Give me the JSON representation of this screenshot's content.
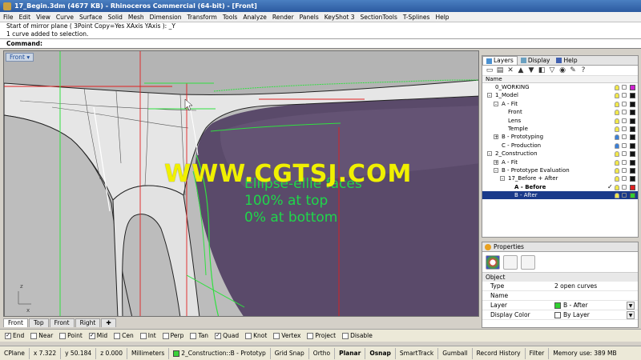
{
  "window": {
    "title": "17_Begin.3dm (4677 KB) - Rhinoceros Commercial (64-bit) - [Front]"
  },
  "menu": [
    "File",
    "Edit",
    "View",
    "Curve",
    "Surface",
    "Solid",
    "Mesh",
    "Dimension",
    "Transform",
    "Tools",
    "Analyze",
    "Render",
    "Panels",
    "KeyShot 3",
    "SectionTools",
    "T-Splines",
    "Help"
  ],
  "command_history": [
    "Start of mirror plane ( 3Point  Copy=Yes  XAxis  YAxis ): _Y",
    "1 curve added to selection."
  ],
  "command_prompt": "Command:",
  "viewport": {
    "label": "Front",
    "overlay_lines": [
      "Ellipse-ellie faces",
      "100%  at top",
      "0% at bottom"
    ],
    "watermark": "WWW.CGTSJ.COM",
    "axis_x": "x",
    "axis_z": "z"
  },
  "viewport_tabs": [
    "Front",
    "Top",
    "Front",
    "Right"
  ],
  "osnap": [
    {
      "label": "End",
      "checked": true
    },
    {
      "label": "Near",
      "checked": false
    },
    {
      "label": "Point",
      "checked": false
    },
    {
      "label": "Mid",
      "checked": true
    },
    {
      "label": "Cen",
      "checked": false
    },
    {
      "label": "Int",
      "checked": false
    },
    {
      "label": "Perp",
      "checked": false
    },
    {
      "label": "Tan",
      "checked": false
    },
    {
      "label": "Quad",
      "checked": true
    },
    {
      "label": "Knot",
      "checked": false
    },
    {
      "label": "Vertex",
      "checked": false
    },
    {
      "label": "Project",
      "checked": false
    },
    {
      "label": "Disable",
      "checked": false
    }
  ],
  "status": {
    "cplane": "CPlane",
    "x": "x 7.322",
    "y": "y 50.184",
    "z": "z 0.000",
    "units": "Millimeters",
    "layer": "2_Construction::B - Prototyp",
    "grid_snap": "Grid Snap",
    "ortho": "Ortho",
    "planar": "Planar",
    "osnap": "Osnap",
    "smarttrack": "SmartTrack",
    "gumball": "Gumball",
    "record_history": "Record History",
    "filter": "Filter",
    "memory": "Memory use: 389 MB"
  },
  "panel_tabs": [
    "Layers",
    "Display",
    "Help"
  ],
  "layers_header": "Name",
  "layers": [
    {
      "name": "0_WORKING",
      "indent": 0,
      "exp": "",
      "color": "#d020d0",
      "bulb": "yellow"
    },
    {
      "name": "1_Model",
      "indent": 0,
      "exp": "-",
      "color": "#111111",
      "bulb": "yellow"
    },
    {
      "name": "A - Fit",
      "indent": 1,
      "exp": "-",
      "color": "#111111",
      "bulb": "yellow"
    },
    {
      "name": "Front",
      "indent": 2,
      "exp": "",
      "color": "#111111",
      "bulb": "yellow"
    },
    {
      "name": "Lens",
      "indent": 2,
      "exp": "",
      "color": "#111111",
      "bulb": "yellow"
    },
    {
      "name": "Temple",
      "indent": 2,
      "exp": "",
      "color": "#111111",
      "bulb": "yellow"
    },
    {
      "name": "B - Prototyping",
      "indent": 1,
      "exp": "+",
      "color": "#111111",
      "bulb": "blue"
    },
    {
      "name": "C - Production",
      "indent": 1,
      "exp": "",
      "color": "#111111",
      "bulb": "blue"
    },
    {
      "name": "2_Construction",
      "indent": 0,
      "exp": "-",
      "color": "#111111",
      "bulb": "yellow"
    },
    {
      "name": "A - Fit",
      "indent": 1,
      "exp": "+",
      "color": "#111111",
      "bulb": "yellow"
    },
    {
      "name": "B - Prototype Evaluation",
      "indent": 1,
      "exp": "-",
      "color": "#111111",
      "bulb": "yellow"
    },
    {
      "name": "17_Before + After",
      "indent": 2,
      "exp": "-",
      "color": "#111111",
      "bulb": "yellow"
    },
    {
      "name": "A - Before",
      "indent": 3,
      "exp": "",
      "color": "#e02020",
      "bulb": "yellow",
      "bold": true,
      "check": "✓"
    },
    {
      "name": "B - After",
      "indent": 3,
      "exp": "",
      "color": "#30d030",
      "bulb": "yellow",
      "selected": true
    }
  ],
  "properties": {
    "title": "Properties",
    "section": "Object",
    "rows": [
      {
        "key": "Type",
        "value": "2 open curves",
        "swatch": "",
        "dropdown": false
      },
      {
        "key": "Name",
        "value": "",
        "swatch": "",
        "dropdown": false
      },
      {
        "key": "Layer",
        "value": "B - After",
        "swatch": "#30d030",
        "dropdown": true
      },
      {
        "key": "Display Color",
        "value": "By Layer",
        "swatch": "#ffffff",
        "dropdown": true
      }
    ]
  },
  "colors": {
    "lens": "#5a4a6a",
    "frame": "#e8e8e8",
    "overlay": "#1fd64a",
    "watermark": "#f0f000",
    "selection": "#1a3a8a"
  }
}
